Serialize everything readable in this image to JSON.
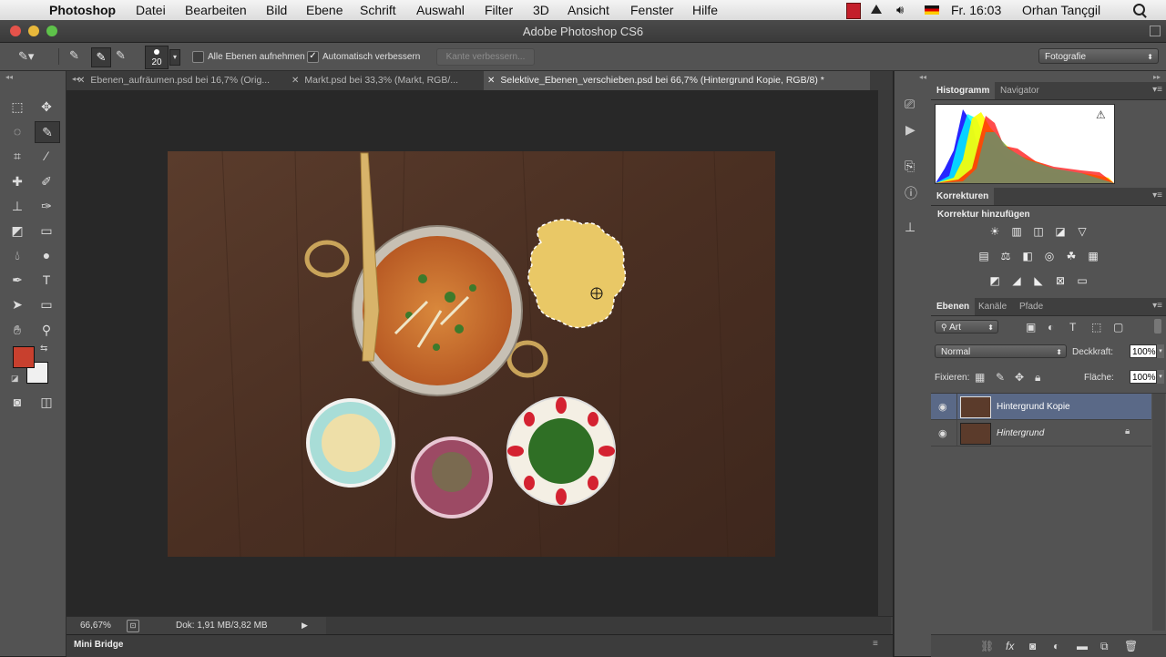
{
  "menubar": {
    "apple": "",
    "app": "Photoshop",
    "items": [
      "Datei",
      "Bearbeiten",
      "Bild",
      "Ebene",
      "Schrift",
      "Auswahl",
      "Filter",
      "3D",
      "Ansicht",
      "Fenster",
      "Hilfe"
    ],
    "clock": "Fr. 16:03",
    "user": "Orhan Tançgil"
  },
  "window": {
    "title": "Adobe Photoshop CS6"
  },
  "options": {
    "brush_size": "20",
    "sample_all_label": "Alle Ebenen aufnehmen",
    "auto_enhance_label": "Automatisch verbessern",
    "refine_edge_label": "Kante verbessern...",
    "workspace": "Fotografie"
  },
  "tabs": [
    {
      "label": "Ebenen_aufräumen.psd bei 16,7% (Orig..."
    },
    {
      "label": "Markt.psd bei 33,3% (Markt, RGB/..."
    },
    {
      "label": "Selektive_Ebenen_verschieben.psd bei 66,7% (Hintergrund Kopie, RGB/8) *"
    }
  ],
  "status": {
    "zoom": "66,67%",
    "doc": "Dok: 1,91 MB/3,82 MB"
  },
  "minibridge": {
    "label": "Mini Bridge"
  },
  "colors": {
    "foreground": "#c8402e",
    "background": "#f0f0f0",
    "panel": "#535353",
    "selected_layer": "#5a6987"
  },
  "panels": {
    "histogram": {
      "tabs": [
        "Histogramm",
        "Navigator"
      ]
    },
    "adjustments": {
      "tab": "Korrekturen",
      "heading": "Korrektur hinzufügen"
    },
    "layers": {
      "tabs": [
        "Ebenen",
        "Kanäle",
        "Pfade"
      ],
      "filter": "Art",
      "blend_mode": "Normal",
      "opacity_label": "Deckkraft:",
      "opacity": "100%",
      "lock_label": "Fixieren:",
      "fill_label": "Fläche:",
      "fill": "100%",
      "items": [
        {
          "name": "Hintergrund Kopie",
          "selected": true
        },
        {
          "name": "Hintergrund",
          "selected": false
        }
      ]
    }
  }
}
